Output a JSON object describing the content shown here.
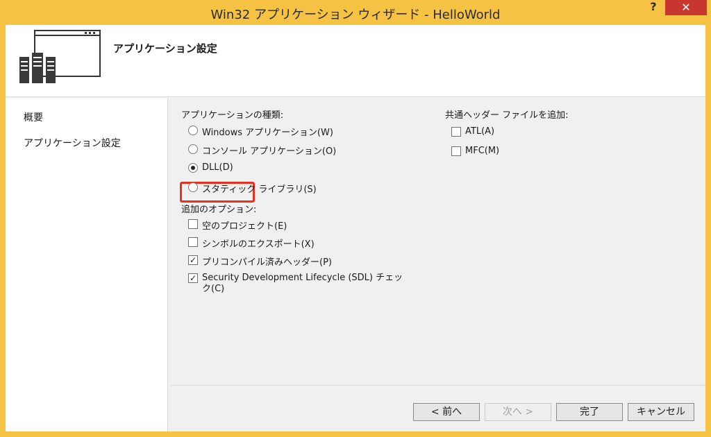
{
  "window": {
    "title": "Win32 アプリケーション ウィザード - HelloWorld",
    "help_label": "?",
    "close_label": "✕"
  },
  "header": {
    "title": "アプリケーション設定",
    "icon": "application-servers-icon"
  },
  "nav": {
    "items": [
      {
        "label": "概要"
      },
      {
        "label": "アプリケーション設定"
      }
    ]
  },
  "app_type": {
    "title": "アプリケーションの種類:",
    "options": [
      {
        "label": "Windows アプリケーション(W)",
        "selected": false
      },
      {
        "label": "コンソール アプリケーション(O)",
        "selected": false
      },
      {
        "label": "DLL(D)",
        "selected": true
      },
      {
        "label": "スタティック ライブラリ(S)",
        "selected": false
      }
    ]
  },
  "additional_options": {
    "title": "追加のオプション:",
    "options": [
      {
        "label": "空のプロジェクト(E)",
        "checked": false
      },
      {
        "label": "シンボルのエクスポート(X)",
        "checked": false
      },
      {
        "label": "プリコンパイル済みヘッダー(P)",
        "checked": true
      },
      {
        "label": "Security Development Lifecycle (SDL) チェック(C)",
        "checked": true
      }
    ]
  },
  "common_headers": {
    "title": "共通ヘッダー ファイルを追加:",
    "options": [
      {
        "label": "ATL(A)",
        "checked": false
      },
      {
        "label": "MFC(M)",
        "checked": false
      }
    ]
  },
  "buttons": {
    "prev": "< 前へ",
    "next": "次へ >",
    "finish": "完了",
    "cancel": "キャンセル"
  },
  "colors": {
    "frame": "#f5c244",
    "close": "#c7372f",
    "highlight": "#e8301c"
  },
  "check_glyph": "✓"
}
